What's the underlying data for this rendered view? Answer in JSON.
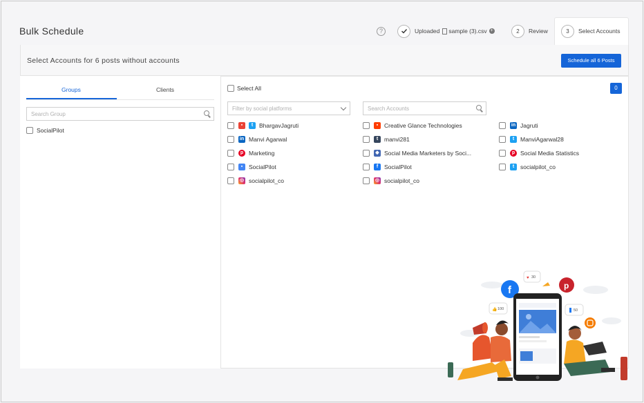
{
  "app": {
    "title": "Bulk Schedule"
  },
  "steps": [
    {
      "icon": "check-icon",
      "label": "Uploaded",
      "file": "sample (3).csv"
    },
    {
      "number": "2",
      "label": "Review"
    },
    {
      "number": "3",
      "label": "Select Accounts"
    }
  ],
  "help_icon": "?",
  "header": {
    "text": "Select Accounts for 6 posts without accounts",
    "button": "Schedule all 6 Posts"
  },
  "left": {
    "tabs": [
      "Groups",
      "Clients"
    ],
    "search_placeholder": "Search Group",
    "groups": [
      "SocialPilot"
    ]
  },
  "right": {
    "select_all": "Select All",
    "selected_count": "0",
    "filter_placeholder": "Filter by social platforms",
    "search_placeholder": "Search Accounts",
    "columns": [
      [
        {
          "name": "BhargavJagruti",
          "icons": [
            "gmb-icon",
            "twitter-icon"
          ]
        },
        {
          "name": "Manvi Agarwal",
          "icons": [
            "linkedin-icon"
          ]
        },
        {
          "name": "Marketing",
          "icons": [
            "pinterest-icon"
          ]
        },
        {
          "name": "SocialPilot",
          "icons": [
            "google-business-icon"
          ]
        },
        {
          "name": "socialpilot_co",
          "icons": [
            "instagram-icon"
          ]
        }
      ],
      [
        {
          "name": "Creative Glance Technologies",
          "icons": [
            "youtube-icon"
          ]
        },
        {
          "name": "manvi281",
          "icons": [
            "tumblr-icon"
          ]
        },
        {
          "name": "Social Media Marketers by Soci...",
          "icons": [
            "group-icon"
          ]
        },
        {
          "name": "SocialPilot",
          "icons": [
            "facebook-icon"
          ]
        },
        {
          "name": "socialpilot_co",
          "icons": [
            "instagram-icon"
          ]
        }
      ],
      [
        {
          "name": "Jagruti",
          "icons": [
            "linkedin-icon"
          ]
        },
        {
          "name": "ManviAgarwal28",
          "icons": [
            "twitter-icon"
          ]
        },
        {
          "name": "Social Media Statistics",
          "icons": [
            "pinterest-icon"
          ]
        },
        {
          "name": "socialpilot_co",
          "icons": [
            "twitter-icon"
          ]
        }
      ]
    ]
  },
  "illustration": {
    "bubbles": [
      "30",
      "100",
      "50"
    ]
  },
  "colors": {
    "primary": "#1565d8"
  }
}
